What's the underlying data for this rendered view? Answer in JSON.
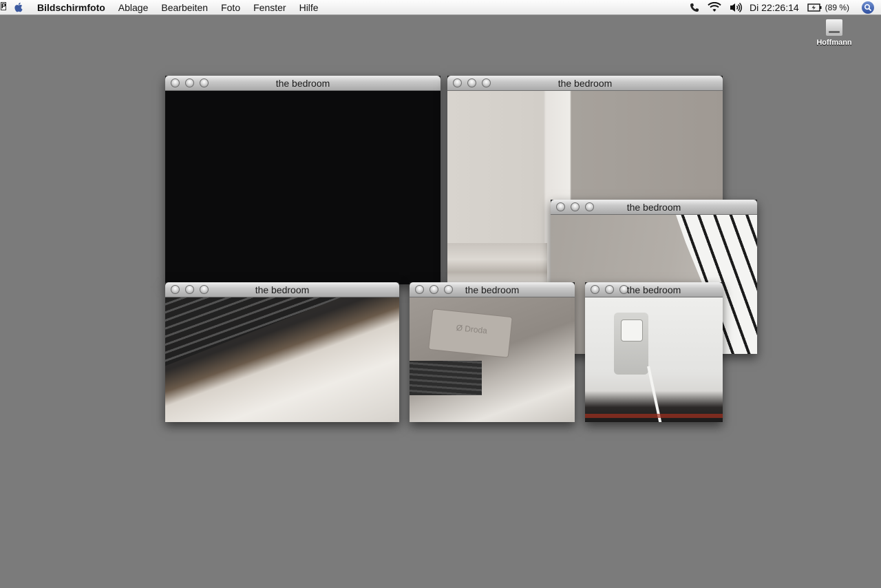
{
  "menubar": {
    "apple_icon": "apple-logo-icon",
    "app_name": "Bildschirmfoto",
    "menus": [
      "Ablage",
      "Bearbeiten",
      "Foto",
      "Fenster",
      "Hilfe"
    ],
    "clock": "Di 22:26:14",
    "battery": "(89 %)",
    "status_icons": [
      "phone-icon",
      "wifi-icon",
      "volume-icon",
      "battery-icon",
      "spotlight-icon"
    ]
  },
  "desktop": {
    "disk_label": "Hoffmann"
  },
  "windows": [
    {
      "title": "the bedroom"
    },
    {
      "title": "the bedroom"
    },
    {
      "title": "the bedroom"
    },
    {
      "title": "the bedroom"
    },
    {
      "title": "the bedroom"
    },
    {
      "title": "the bedroom"
    }
  ],
  "photo_text": {
    "radiator_brand": "Ø Droda"
  }
}
